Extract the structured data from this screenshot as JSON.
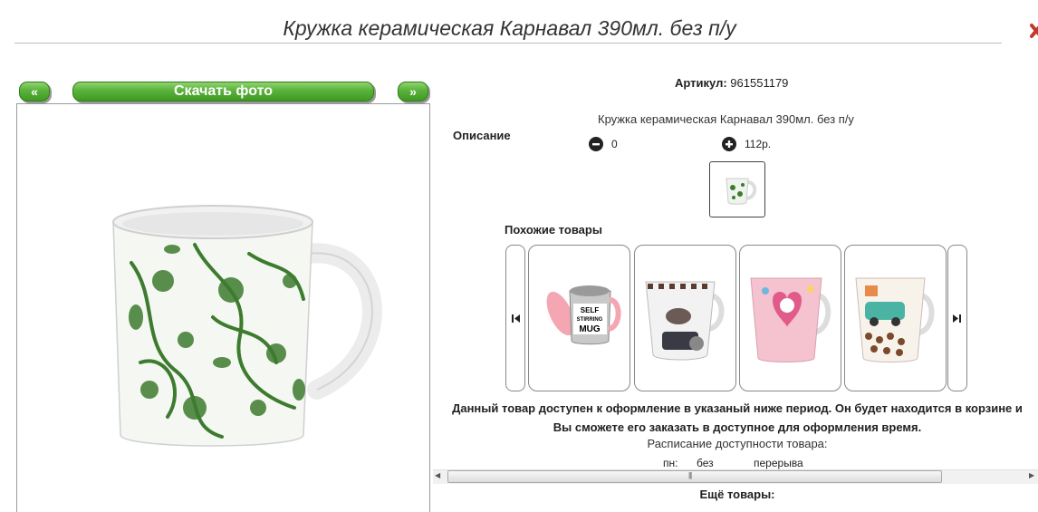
{
  "header": {
    "title": "Кружка керамическая Карнавал 390мл. без п/у"
  },
  "gallery": {
    "prev_label": "«",
    "download_label": "Скачать фото",
    "next_label": "»"
  },
  "product": {
    "article_label": "Артикул:",
    "article_value": "961551179",
    "description_label": "Описание",
    "description_text": "Кружка керамическая Карнавал 390мл. без п/у",
    "minus_value": "0",
    "plus_value": "112р."
  },
  "similar": {
    "label": "Похожие товары",
    "products": [
      {
        "image": "self-stirring-mug-photo"
      },
      {
        "image": "fashion-mug-photo"
      },
      {
        "image": "pink-heart-mug-photo"
      },
      {
        "image": "car-print-mug-photo"
      }
    ]
  },
  "availability": {
    "text": "Данный товар доступен к оформление в указаный ниже период. Он будет находится в корзине и Вы сможете его заказать в доступное для оформления время.",
    "schedule_label": "Расписание доступности товара:",
    "day": "пн:",
    "no": "без",
    "break": "перерыва"
  },
  "more": {
    "label": "Ещё товары:"
  },
  "colors": {
    "accent_green": "#59b13a",
    "border_gray": "#9a9a9a"
  }
}
